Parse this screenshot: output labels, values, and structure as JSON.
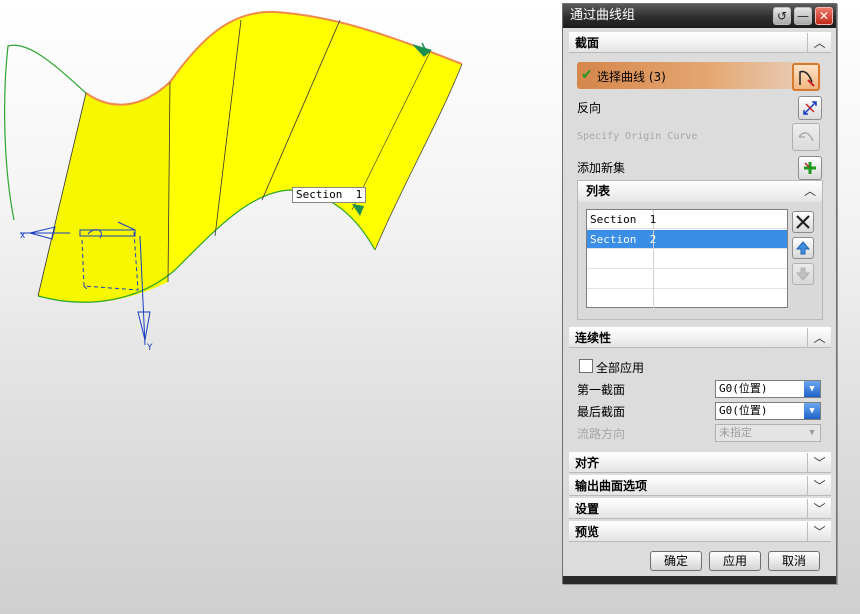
{
  "viewport": {
    "section_label": "Section  1"
  },
  "dialog": {
    "title": "通过曲线组",
    "title_buttons": [
      "↺",
      "—",
      "✕"
    ],
    "section_group": {
      "header": "截面",
      "select_curve_label": "选择曲线 (3)",
      "reverse_label": "反向",
      "origin_curve_label": "Specify Origin Curve",
      "add_new_set_label": "添加新集"
    },
    "list_group": {
      "header": "列表",
      "rows": [
        "Section  1",
        "Section  2",
        "",
        "",
        ""
      ],
      "selected_index": 1
    },
    "continuity_group": {
      "header": "连续性",
      "apply_all_label": "全部应用",
      "apply_all_checked": false,
      "first_section_label": "第一截面",
      "first_section_value": "G0(位置)",
      "last_section_label": "最后截面",
      "last_section_value": "G0(位置)",
      "flow_direction_label": "流路方向",
      "flow_direction_value": "未指定"
    },
    "collapsed_groups": [
      "对齐",
      "输出曲面选项",
      "设置",
      "预览"
    ],
    "buttons": {
      "ok": "确定",
      "apply": "应用",
      "cancel": "取消"
    },
    "colors": {
      "surface": "#ffff00",
      "selection_highlight": "#3a8ee6",
      "active_selection": "#e5a873"
    }
  }
}
